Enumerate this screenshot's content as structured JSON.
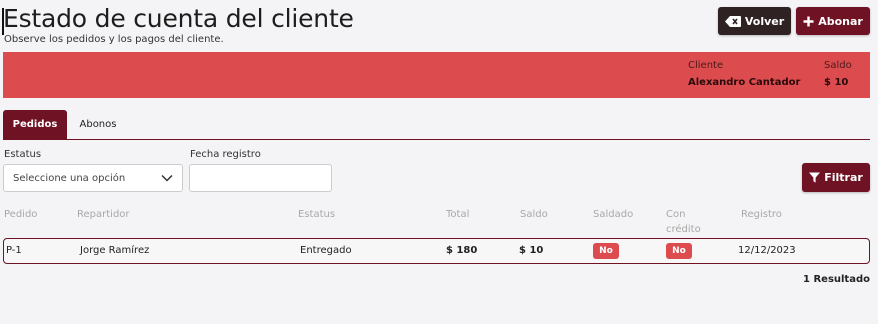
{
  "header": {
    "title": "Estado de cuenta del cliente",
    "subtitle": "Observe los pedidos y los pagos del cliente.",
    "volver_label": "Volver",
    "abonar_label": "Abonar",
    "volver_icon": "backspace-icon",
    "abonar_icon": "plus-icon"
  },
  "summary": {
    "cliente_label": "Cliente",
    "cliente_value": "Alexandro Cantador",
    "saldo_label": "Saldo",
    "saldo_value": "$ 10",
    "background_color": "#dc4c4e"
  },
  "tabs": [
    {
      "label": "Pedidos",
      "active": true
    },
    {
      "label": "Abonos",
      "active": false
    }
  ],
  "filters": {
    "estatus_label": "Estatus",
    "estatus_selected": "Seleccione una opción",
    "fecha_label": "Fecha registro",
    "fecha_value": "",
    "filtrar_label": "Filtrar",
    "filtrar_icon": "funnel-icon"
  },
  "table": {
    "columns": [
      "Pedido",
      "Repartidor",
      "Estatus",
      "Total",
      "Saldo",
      "Saldado",
      "Con crédito",
      "Registro"
    ],
    "rows": [
      {
        "pedido": "P-1",
        "repartidor": "Jorge Ramírez",
        "estatus": "Entregado",
        "total": "$ 180",
        "saldo": "$ 10",
        "saldado": "No",
        "con_credito": "No",
        "registro": "12/12/2023"
      }
    ]
  },
  "results": "1 Resultado",
  "colors": {
    "primary": "#6e1224",
    "dark_button": "#2e2222",
    "badge": "#dc4c4e"
  }
}
